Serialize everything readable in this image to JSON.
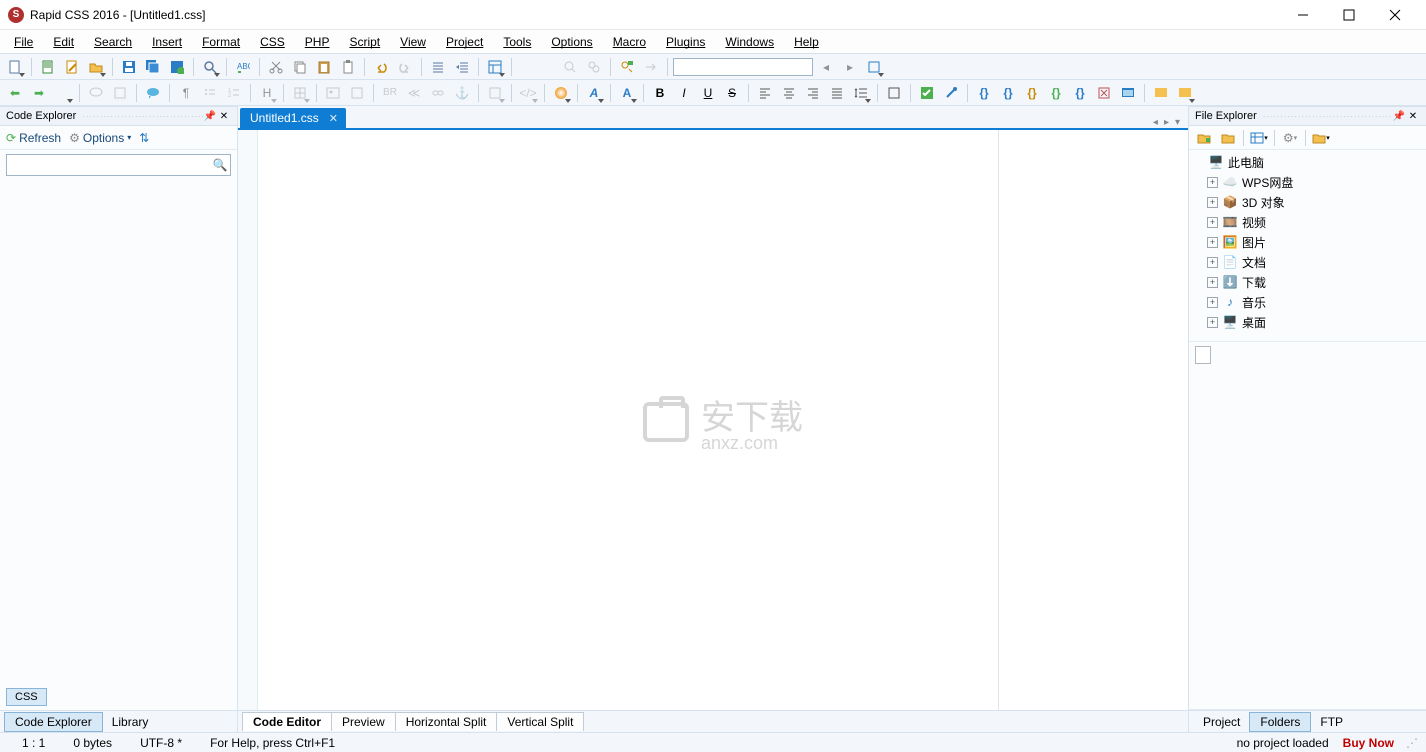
{
  "titlebar": {
    "title": "Rapid CSS 2016 - [Untitled1.css]"
  },
  "menubar": {
    "items": [
      "File",
      "Edit",
      "Search",
      "Insert",
      "Format",
      "CSS",
      "PHP",
      "Script",
      "View",
      "Project",
      "Tools",
      "Options",
      "Macro",
      "Plugins",
      "Windows",
      "Help"
    ]
  },
  "leftPanel": {
    "title": "Code Explorer",
    "refresh": "Refresh",
    "options": "Options",
    "cssBadge": "CSS"
  },
  "docTabs": {
    "tab1": "Untitled1.css"
  },
  "watermark": {
    "big": "安下载",
    "sub": "anxz.com"
  },
  "rightPanel": {
    "title": "File Explorer",
    "nodes": [
      {
        "label": "此电脑",
        "icon": "pc",
        "exp": false,
        "indent": 0
      },
      {
        "label": "WPS网盘",
        "icon": "cloud",
        "exp": true,
        "indent": 1
      },
      {
        "label": "3D 对象",
        "icon": "cube",
        "exp": true,
        "indent": 1
      },
      {
        "label": "视频",
        "icon": "video",
        "exp": true,
        "indent": 1
      },
      {
        "label": "图片",
        "icon": "image",
        "exp": true,
        "indent": 1
      },
      {
        "label": "文档",
        "icon": "doc",
        "exp": true,
        "indent": 1
      },
      {
        "label": "下载",
        "icon": "download",
        "exp": true,
        "indent": 1
      },
      {
        "label": "音乐",
        "icon": "music",
        "exp": true,
        "indent": 1
      },
      {
        "label": "桌面",
        "icon": "desktop",
        "exp": true,
        "indent": 1
      }
    ]
  },
  "bottomTabs": {
    "left": [
      "Code Explorer",
      "Library"
    ],
    "center": [
      "Code Editor",
      "Preview",
      "Horizontal Split",
      "Vertical Split"
    ],
    "right": [
      "Project",
      "Folders",
      "FTP"
    ]
  },
  "status": {
    "pos": "1 : 1",
    "size": "0 bytes",
    "enc": "UTF-8 *",
    "help": "For Help, press Ctrl+F1",
    "proj": "no project loaded",
    "buy": "Buy Now"
  }
}
